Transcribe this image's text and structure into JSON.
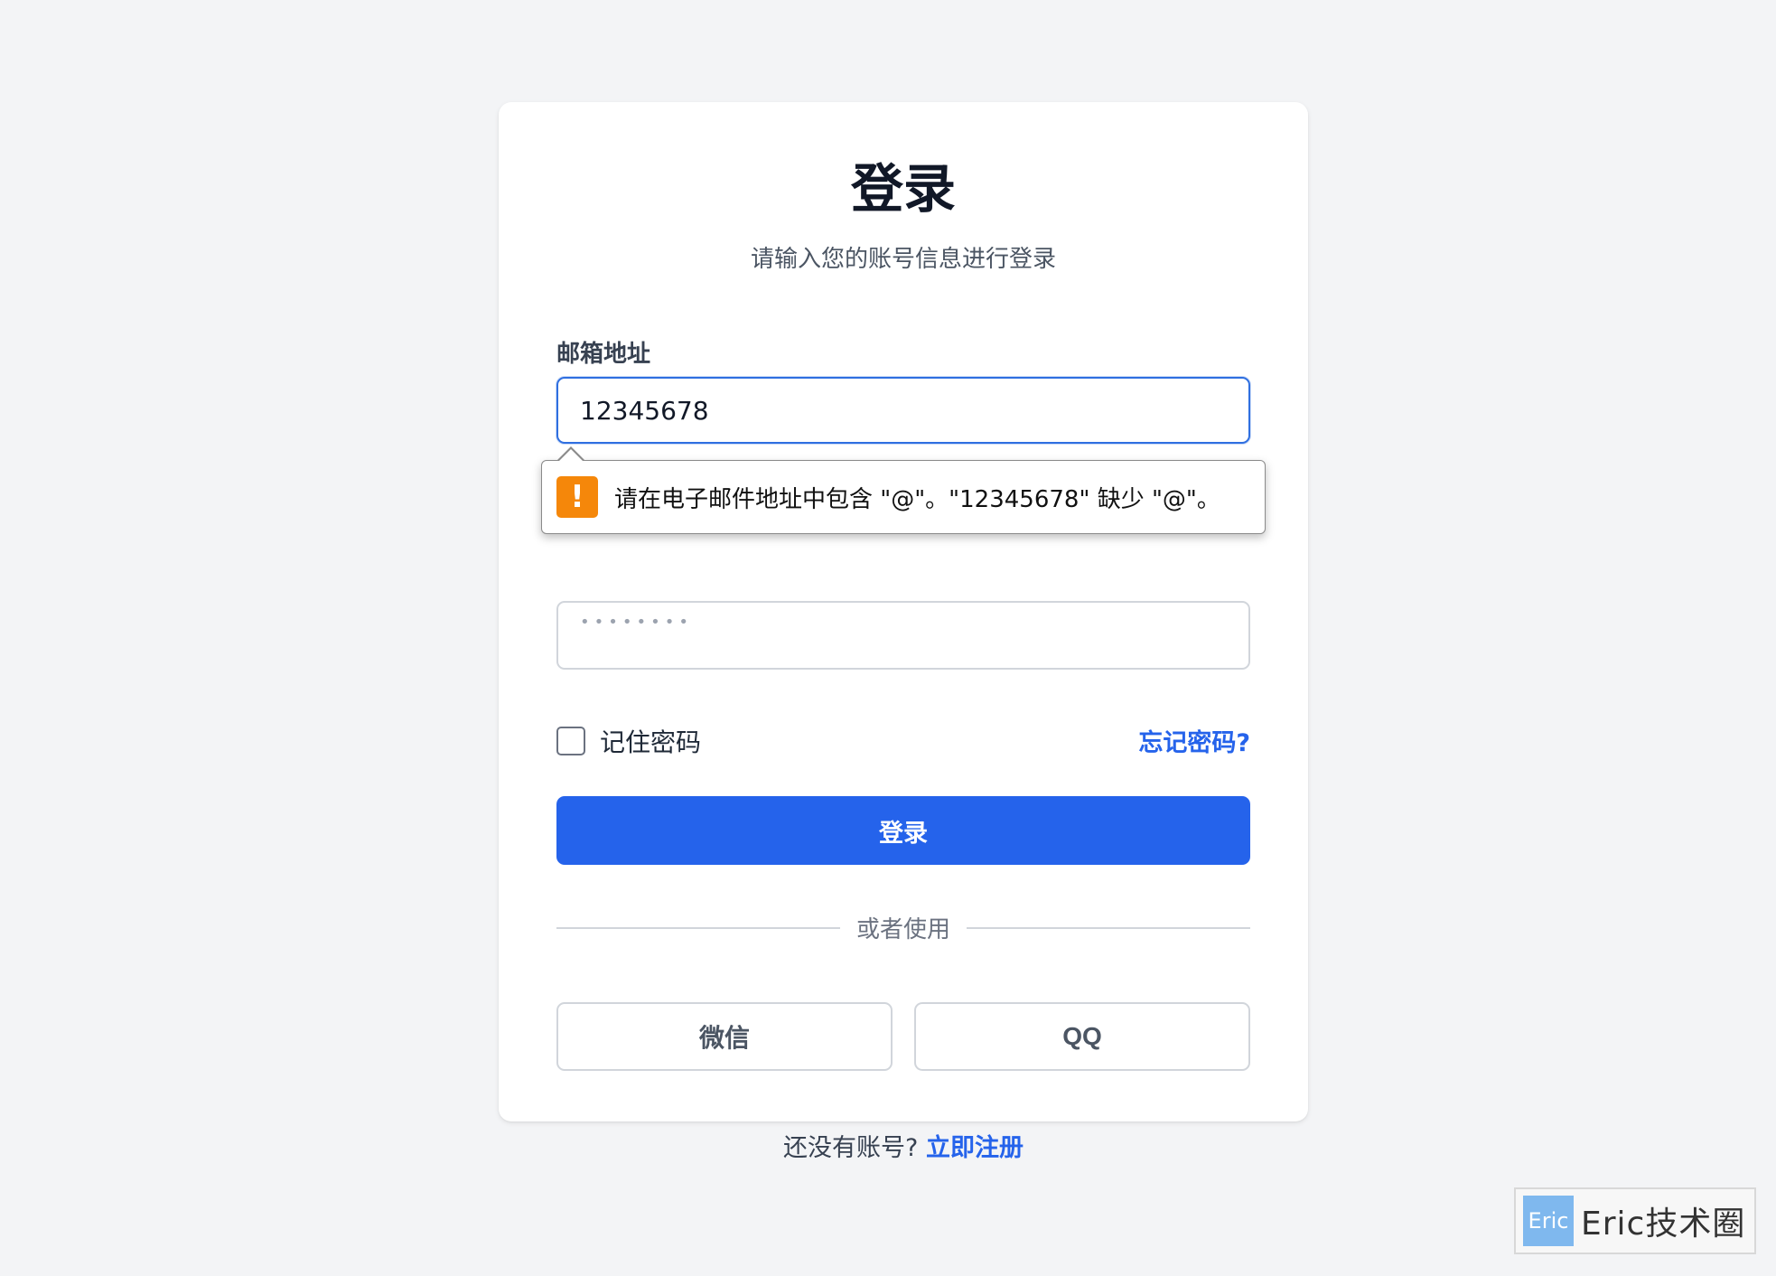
{
  "login": {
    "title": "登录",
    "subtitle": "请输入您的账号信息进行登录",
    "email_label": "邮箱地址",
    "email_value": "12345678",
    "password_mask": "••••••••",
    "remember_label": "记住密码",
    "forgot_label": "忘记密码?",
    "submit_label": "登录",
    "divider_text": "或者使用",
    "wechat_label": "微信",
    "qq_label": "QQ",
    "register_prompt": "还没有账号? ",
    "register_link": "立即注册"
  },
  "validation": {
    "icon": "!",
    "message": "请在电子邮件地址中包含 \"@\"。\"12345678\" 缺少 \"@\"。"
  },
  "watermark": {
    "logo_text": "Eric",
    "text": "Eric技术圈"
  },
  "colors": {
    "accent": "#2563eb",
    "warning": "#f5870a",
    "background": "#f3f4f6"
  }
}
